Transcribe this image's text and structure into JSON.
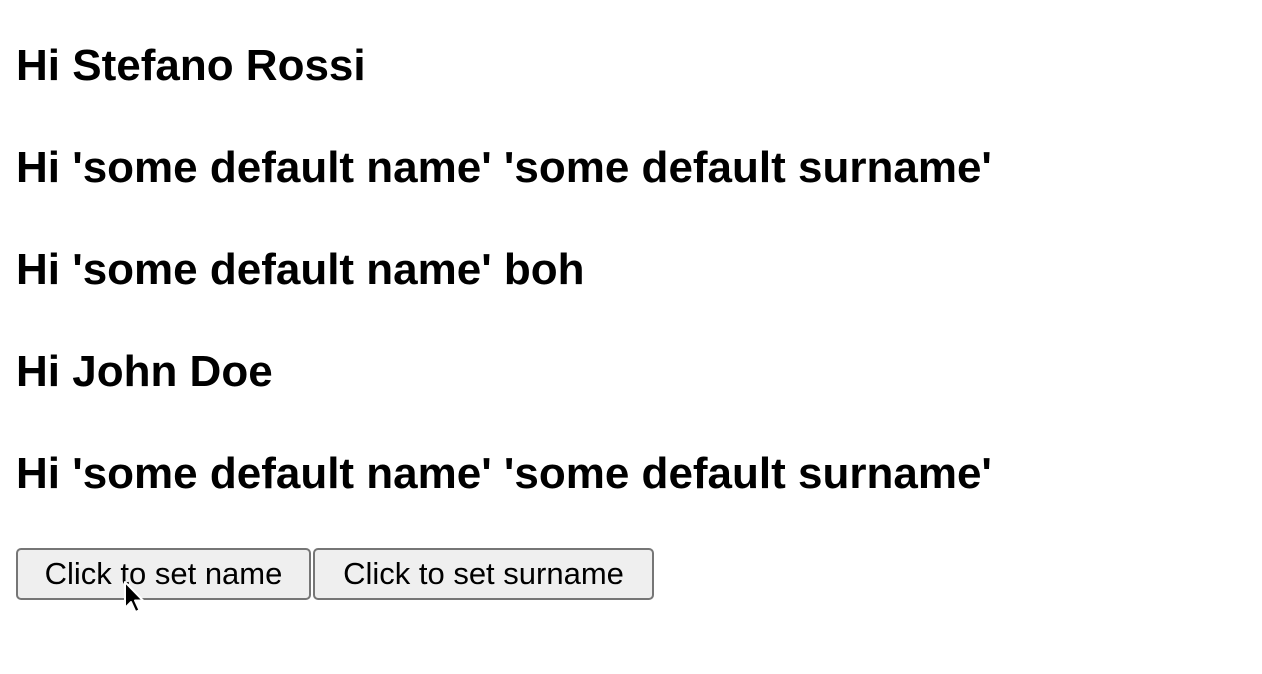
{
  "greetings": [
    "Hi Stefano Rossi",
    "Hi 'some default name' 'some default surname'",
    "Hi 'some default name' boh",
    "Hi John Doe",
    "Hi 'some default name' 'some default surname'"
  ],
  "buttons": {
    "set_name_label": "Click to set name",
    "set_surname_label": "Click to set surname"
  },
  "cursor": {
    "icon": "arrow-cursor-icon"
  }
}
